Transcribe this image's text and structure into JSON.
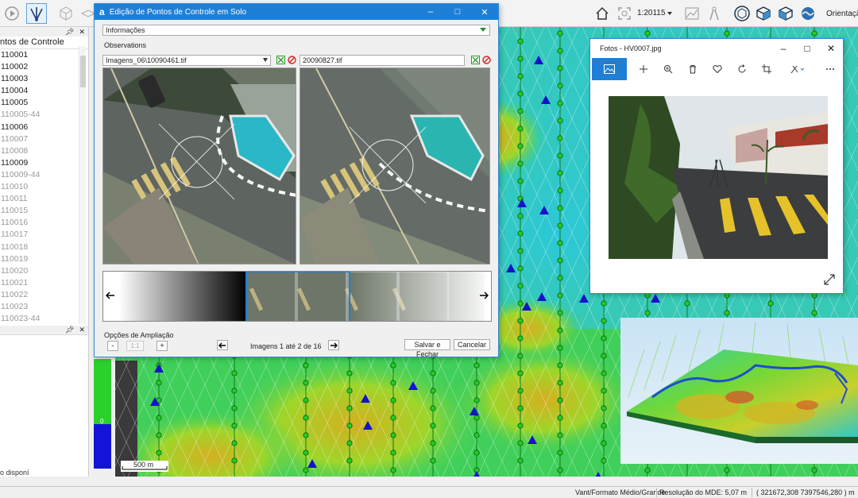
{
  "toolbar": {
    "scale": "1:20115",
    "orientation_label": "Orientação"
  },
  "control_points": {
    "title": "ntos de Controle",
    "items": [
      {
        "label": "110001",
        "state": "active"
      },
      {
        "label": "110002",
        "state": "active"
      },
      {
        "label": "110003",
        "state": "active"
      },
      {
        "label": "110004",
        "state": "active"
      },
      {
        "label": "110005",
        "state": "active"
      },
      {
        "label": "110005-44",
        "state": "inactive"
      },
      {
        "label": "110006",
        "state": "active"
      },
      {
        "label": "110007",
        "state": "inactive"
      },
      {
        "label": "110008",
        "state": "inactive"
      },
      {
        "label": "110009",
        "state": "active"
      },
      {
        "label": "110009-44",
        "state": "inactive"
      },
      {
        "label": "110010",
        "state": "inactive"
      },
      {
        "label": "110011",
        "state": "inactive"
      },
      {
        "label": "110015",
        "state": "inactive"
      },
      {
        "label": "110016",
        "state": "inactive"
      },
      {
        "label": "110017",
        "state": "inactive"
      },
      {
        "label": "110018",
        "state": "inactive"
      },
      {
        "label": "110019",
        "state": "inactive"
      },
      {
        "label": "110020",
        "state": "inactive"
      },
      {
        "label": "110021",
        "state": "inactive"
      },
      {
        "label": "110022",
        "state": "inactive"
      },
      {
        "label": "110023",
        "state": "inactive"
      },
      {
        "label": "110023-44",
        "state": "inactive"
      }
    ]
  },
  "lower_panel": {
    "legend_zero": "0",
    "disp_text": "o disponí"
  },
  "map": {
    "scalebar_label": "500 m"
  },
  "dialog": {
    "title": "Edição de Pontos de Controle em Solo",
    "section": "Informações",
    "observations_label": "Observations",
    "left_image": "Imagens_06\\10090461.tif",
    "right_image": "20090827.tif",
    "zoom_label": "Opções de Ampliação",
    "zoom_minus": "-",
    "zoom_value": "1:1",
    "zoom_plus": "+",
    "image_count": "Imagens 1 até 2 de 16",
    "save_close": "Salvar e Fechar",
    "cancel": "Cancelar"
  },
  "photos": {
    "title": "Fotos - HV0007.jpg"
  },
  "statusbar": {
    "project": "Vant/Formato Médio/Grande",
    "resolution": "Resolução do MDE: 5,07 m",
    "coords": "( 321672,308 7397546,280 ) m"
  },
  "colors": {
    "accent": "#1e7fd6",
    "triangle": "#1414c8",
    "point_green": "#22cc22"
  }
}
